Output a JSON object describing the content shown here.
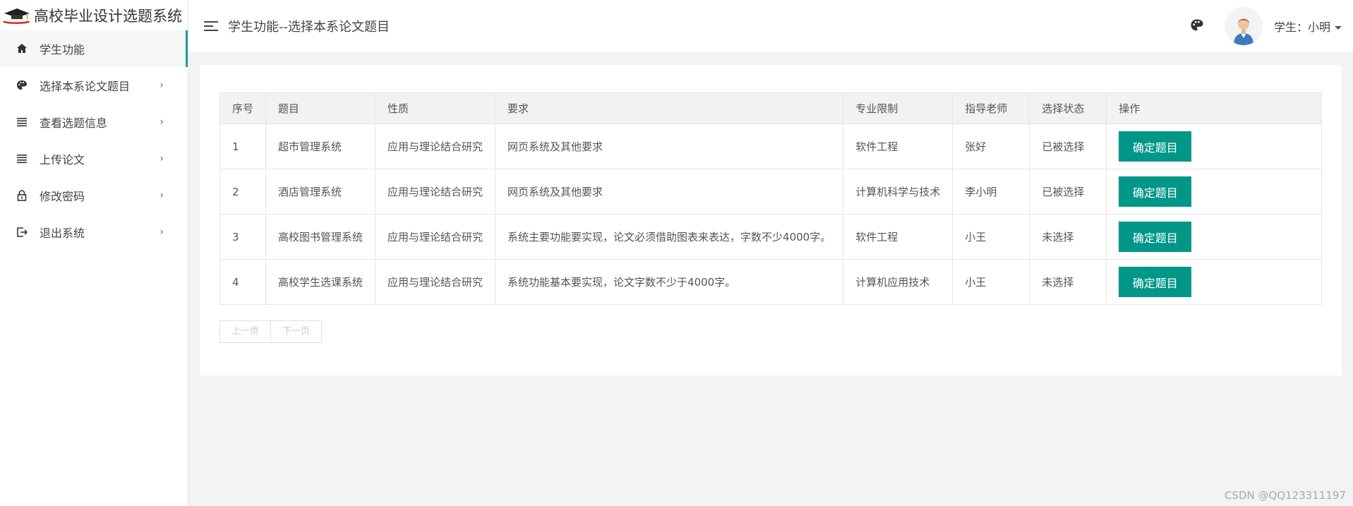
{
  "app": {
    "title": "高校毕业设计选题系统"
  },
  "sidebar": {
    "items": [
      {
        "label": "学生功能",
        "icon": "home-icon",
        "active": true,
        "has_arrow": false
      },
      {
        "label": "选择本系论文题目",
        "icon": "palette-icon",
        "active": false,
        "has_arrow": true
      },
      {
        "label": "查看选题信息",
        "icon": "list-icon",
        "active": false,
        "has_arrow": true
      },
      {
        "label": "上传论文",
        "icon": "list-icon",
        "active": false,
        "has_arrow": true
      },
      {
        "label": "修改密码",
        "icon": "lock-icon",
        "active": false,
        "has_arrow": true
      },
      {
        "label": "退出系统",
        "icon": "logout-icon",
        "active": false,
        "has_arrow": true
      }
    ],
    "arrow": "›"
  },
  "header": {
    "title": "学生功能--选择本系论文题目",
    "user_label": "学生：小明"
  },
  "table": {
    "columns": [
      "序号",
      "题目",
      "性质",
      "要求",
      "专业限制",
      "指导老师",
      "选择状态",
      "操作"
    ],
    "rows": [
      {
        "no": "1",
        "topic": "超市管理系统",
        "nature": "应用与理论结合研究",
        "requirement": "网页系统及其他要求",
        "major": "软件工程",
        "teacher": "张好",
        "status": "已被选择",
        "action": "确定题目"
      },
      {
        "no": "2",
        "topic": "酒店管理系统",
        "nature": "应用与理论结合研究",
        "requirement": "网页系统及其他要求",
        "major": "计算机科学与技术",
        "teacher": "李小明",
        "status": "已被选择",
        "action": "确定题目"
      },
      {
        "no": "3",
        "topic": "高校图书管理系统",
        "nature": "应用与理论结合研究",
        "requirement": "系统主要功能要实现，论文必须借助图表来表达，字数不少4000字。",
        "major": "软件工程",
        "teacher": "小王",
        "status": "未选择",
        "action": "确定题目"
      },
      {
        "no": "4",
        "topic": "高校学生选课系统",
        "nature": "应用与理论结合研究",
        "requirement": "系统功能基本要实现，论文字数不少于4000字。",
        "major": "计算机应用技术",
        "teacher": "小王",
        "status": "未选择",
        "action": "确定题目"
      }
    ]
  },
  "pagination": {
    "prev": "上一页",
    "next": "下一页"
  },
  "watermark": "CSDN @QQ123311197",
  "colors": {
    "accent": "#009688",
    "active_bar": "#1aa094",
    "background": "#f2f3f5"
  }
}
